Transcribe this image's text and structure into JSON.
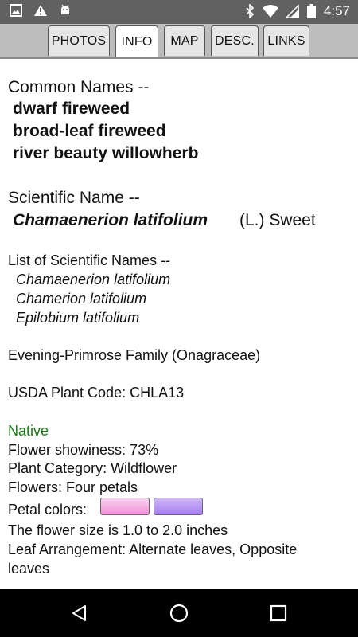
{
  "status_bar": {
    "time": "4:57"
  },
  "tabs": [
    {
      "label": "PHOTOS",
      "active": false
    },
    {
      "label": "INFO",
      "active": true
    },
    {
      "label": "MAP",
      "active": false
    },
    {
      "label": "DESC.",
      "active": false
    },
    {
      "label": "LINKS",
      "active": false
    }
  ],
  "info": {
    "common_names_heading": "Common Names --",
    "common_names": [
      "dwarf fireweed",
      "broad-leaf fireweed",
      "river beauty willowherb"
    ],
    "scientific_name_heading": "Scientific Name --",
    "scientific_name": "Chamaenerion latifolium",
    "scientific_author": "(L.) Sweet",
    "scientific_list_heading": "List of Scientific Names --",
    "scientific_list": [
      "Chamaenerion latifolium",
      "Chamerion latifolium",
      "Epilobium latifolium"
    ],
    "family": "Evening-Primrose Family (Onagraceae)",
    "usda_code": "USDA Plant Code: CHLA13",
    "native": "Native",
    "showiness": "Flower showiness: 73%",
    "category": "Plant Category: Wildflower",
    "flowers": "Flowers: Four petals",
    "petal_colors_label": "Petal colors:",
    "petal_colors": [
      "#f28fd6",
      "#a77ef0"
    ],
    "flower_size": "The flower size is 1.0 to 2.0 inches",
    "leaf_arrangement_line1": "Leaf Arrangement: Alternate leaves, Opposite",
    "leaf_arrangement_line2": "leaves"
  },
  "nav_icons": [
    "back-icon",
    "home-icon",
    "recents-icon"
  ]
}
